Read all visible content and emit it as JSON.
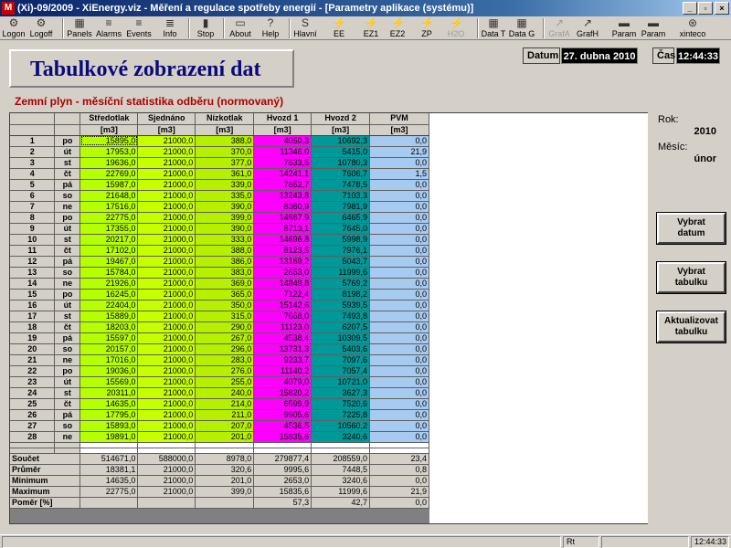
{
  "window": {
    "title": "(Xi)-09/2009 - XiEnergy.viz - Měření a regulace spotřeby energií - [Parametry aplikace (systému)]",
    "logo_text": "M",
    "controls": [
      "_",
      "▫",
      "×"
    ]
  },
  "toolbar": {
    "items": [
      {
        "label": "Logon",
        "icon": "logon-icon",
        "glyph": "⚙"
      },
      {
        "label": "Logoff",
        "icon": "logoff-icon",
        "glyph": "⚙"
      },
      {
        "label": "Panels",
        "icon": "panels-icon",
        "glyph": "▦"
      },
      {
        "label": "Alarms",
        "icon": "alarms-icon",
        "glyph": "≡"
      },
      {
        "label": "Events",
        "icon": "events-icon",
        "glyph": "≡"
      },
      {
        "label": "Info",
        "icon": "info-icon",
        "glyph": "≣"
      },
      {
        "label": "Stop",
        "icon": "stop-icon",
        "glyph": "▮"
      },
      {
        "label": "About",
        "icon": "about-icon",
        "glyph": "▭"
      },
      {
        "label": "Help",
        "icon": "help-icon",
        "glyph": "?"
      },
      {
        "label": "Hlavní",
        "icon": "hlavni-icon",
        "glyph": "S"
      },
      {
        "label": "EE",
        "icon": "ee-icon",
        "glyph": "⚡"
      },
      {
        "label": "EZ1",
        "icon": "ez1-icon",
        "glyph": "⚡"
      },
      {
        "label": "EZ2",
        "icon": "ez2-icon",
        "glyph": "⚡"
      },
      {
        "label": "ZP",
        "icon": "zp-icon",
        "glyph": "⚡"
      },
      {
        "label": "H2O",
        "icon": "h2o-icon",
        "glyph": "⚡",
        "disabled": true
      },
      {
        "label": "Data T",
        "icon": "data-t-icon",
        "glyph": "▦"
      },
      {
        "label": "Data G",
        "icon": "data-g-icon",
        "glyph": "▦"
      },
      {
        "label": "GrafA",
        "icon": "grafa-icon",
        "glyph": "↗",
        "disabled": true
      },
      {
        "label": "GrafH",
        "icon": "grafh-icon",
        "glyph": "↗"
      },
      {
        "label": "Param",
        "icon": "param1-icon",
        "glyph": "▬"
      },
      {
        "label": "Param",
        "icon": "param2-icon",
        "glyph": "▬"
      },
      {
        "label": "xinteco",
        "icon": "xinteco-icon",
        "glyph": "⊛"
      }
    ]
  },
  "header": {
    "title": "Tabulkové zobrazení dat",
    "date_label": "Datum",
    "date_value": "27. dubna 2010",
    "time_label": "Čas",
    "time_value": "12:44:33"
  },
  "subtitle": "Zemní plyn - měsíční statistika odběru (normovaný)",
  "table": {
    "columns": [
      {
        "name": "Středotlak",
        "unit": "[m3]"
      },
      {
        "name": "Sjednáno",
        "unit": "[m3]"
      },
      {
        "name": "Nízkotlak",
        "unit": "[m3]"
      },
      {
        "name": "Hvozd 1",
        "unit": "[m3]"
      },
      {
        "name": "Hvozd 2",
        "unit": "[m3]"
      },
      {
        "name": "PVM",
        "unit": "[m3]"
      }
    ],
    "rows": [
      {
        "day": "1",
        "wd": "po",
        "v": [
          "15895,0",
          "21000,0",
          "388,0",
          "4050,3",
          "10692,3",
          "0,0"
        ]
      },
      {
        "day": "2",
        "wd": "út",
        "v": [
          "17953,0",
          "21000,0",
          "370,0",
          "11346,0",
          "5415,0",
          "21,9"
        ]
      },
      {
        "day": "3",
        "wd": "st",
        "v": [
          "19636,0",
          "21000,0",
          "377,0",
          "7633,5",
          "10780,3",
          "0,0"
        ]
      },
      {
        "day": "4",
        "wd": "čt",
        "v": [
          "22769,0",
          "21000,0",
          "361,0",
          "14241,1",
          "7606,7",
          "1,5"
        ]
      },
      {
        "day": "5",
        "wd": "pá",
        "v": [
          "15987,0",
          "21000,0",
          "339,0",
          "7652,7",
          "7478,5",
          "0,0"
        ]
      },
      {
        "day": "6",
        "wd": "so",
        "v": [
          "21648,0",
          "21000,0",
          "335,0",
          "13243,8",
          "7103,3",
          "0,0"
        ]
      },
      {
        "day": "7",
        "wd": "ne",
        "v": [
          "17516,0",
          "21000,0",
          "390,0",
          "8360,9",
          "7981,9",
          "0,0"
        ]
      },
      {
        "day": "8",
        "wd": "po",
        "v": [
          "22775,0",
          "21000,0",
          "399,0",
          "14667,9",
          "6465,9",
          "0,0"
        ]
      },
      {
        "day": "9",
        "wd": "út",
        "v": [
          "17355,0",
          "21000,0",
          "390,0",
          "8713,1",
          "7645,0",
          "0,0"
        ]
      },
      {
        "day": "10",
        "wd": "st",
        "v": [
          "20217,0",
          "21000,0",
          "333,0",
          "14696,8",
          "5998,9",
          "0,0"
        ]
      },
      {
        "day": "11",
        "wd": "čt",
        "v": [
          "17102,0",
          "21000,0",
          "388,0",
          "8123,5",
          "7976,1",
          "0,0"
        ]
      },
      {
        "day": "12",
        "wd": "pá",
        "v": [
          "19467,0",
          "21000,0",
          "386,0",
          "13169,2",
          "5043,7",
          "0,0"
        ]
      },
      {
        "day": "13",
        "wd": "so",
        "v": [
          "15784,0",
          "21000,0",
          "383,0",
          "2653,0",
          "11999,6",
          "0,0"
        ]
      },
      {
        "day": "14",
        "wd": "ne",
        "v": [
          "21926,0",
          "21000,0",
          "369,0",
          "14849,8",
          "5769,2",
          "0,0"
        ]
      },
      {
        "day": "15",
        "wd": "po",
        "v": [
          "16245,0",
          "21000,0",
          "365,0",
          "7122,4",
          "8198,2",
          "0,0"
        ]
      },
      {
        "day": "16",
        "wd": "út",
        "v": [
          "22404,0",
          "21000,0",
          "350,0",
          "15142,6",
          "5939,5",
          "0,0"
        ]
      },
      {
        "day": "17",
        "wd": "st",
        "v": [
          "15889,0",
          "21000,0",
          "315,0",
          "7668,0",
          "7493,8",
          "0,0"
        ]
      },
      {
        "day": "18",
        "wd": "čt",
        "v": [
          "18203,0",
          "21000,0",
          "290,0",
          "11123,0",
          "6207,5",
          "0,0"
        ]
      },
      {
        "day": "19",
        "wd": "pá",
        "v": [
          "15597,0",
          "21000,0",
          "267,0",
          "4538,4",
          "10309,5",
          "0,0"
        ]
      },
      {
        "day": "20",
        "wd": "so",
        "v": [
          "20157,0",
          "21000,0",
          "296,0",
          "13731,3",
          "5403,6",
          "0,0"
        ]
      },
      {
        "day": "21",
        "wd": "ne",
        "v": [
          "17016,0",
          "21000,0",
          "283,0",
          "9233,7",
          "7097,6",
          "0,0"
        ]
      },
      {
        "day": "22",
        "wd": "po",
        "v": [
          "19036,0",
          "21000,0",
          "276,0",
          "11140,2",
          "7057,4",
          "0,0"
        ]
      },
      {
        "day": "23",
        "wd": "út",
        "v": [
          "15569,0",
          "21000,0",
          "255,0",
          "4079,0",
          "10721,0",
          "0,0"
        ]
      },
      {
        "day": "24",
        "wd": "st",
        "v": [
          "20311,0",
          "21000,0",
          "240,0",
          "15820,2",
          "3627,3",
          "0,0"
        ]
      },
      {
        "day": "25",
        "wd": "čt",
        "v": [
          "14635,0",
          "21000,0",
          "214,0",
          "6599,9",
          "7520,6",
          "0,0"
        ]
      },
      {
        "day": "26",
        "wd": "pá",
        "v": [
          "17795,0",
          "21000,0",
          "211,0",
          "9905,6",
          "7225,8",
          "0,0"
        ]
      },
      {
        "day": "27",
        "wd": "so",
        "v": [
          "15893,0",
          "21000,0",
          "207,0",
          "4536,5",
          "10560,2",
          "0,0"
        ]
      },
      {
        "day": "28",
        "wd": "ne",
        "v": [
          "19891,0",
          "21000,0",
          "201,0",
          "15835,6",
          "3240,6",
          "0,0"
        ]
      }
    ],
    "stats": [
      {
        "label": "Součet",
        "v": [
          "514671,0",
          "588000,0",
          "8978,0",
          "279877,4",
          "208559,0",
          "23,4"
        ]
      },
      {
        "label": "Průměr",
        "v": [
          "18381,1",
          "21000,0",
          "320,6",
          "9995,6",
          "7448,5",
          "0,8"
        ]
      },
      {
        "label": "Minimum",
        "v": [
          "14635,0",
          "21000,0",
          "201,0",
          "2653,0",
          "3240,6",
          "0,0"
        ]
      },
      {
        "label": "Maximum",
        "v": [
          "22775,0",
          "21000,0",
          "399,0",
          "15835,6",
          "11999,6",
          "21,9"
        ]
      },
      {
        "label": "Poměr [%]",
        "v": [
          "",
          "",
          "",
          "57,3",
          "42,7",
          "0,0"
        ]
      }
    ]
  },
  "side": {
    "year_label": "Rok:",
    "year_value": "2010",
    "month_label": "Měsíc:",
    "month_value": "únor",
    "buttons": [
      "Vybrat\ndatum",
      "Vybrat\ntabulku",
      "Aktualizovat\ntabulku"
    ]
  },
  "statusbar": {
    "mode": "Rt",
    "time": "12:44:33"
  },
  "colors": {
    "stredotlak": "#b6ff00",
    "hvozd1": "#ff00ff",
    "hvozd2": "#009999",
    "pvm": "#a6caf0",
    "subtitle": "#aa0000",
    "title": "#0a0a7a"
  }
}
